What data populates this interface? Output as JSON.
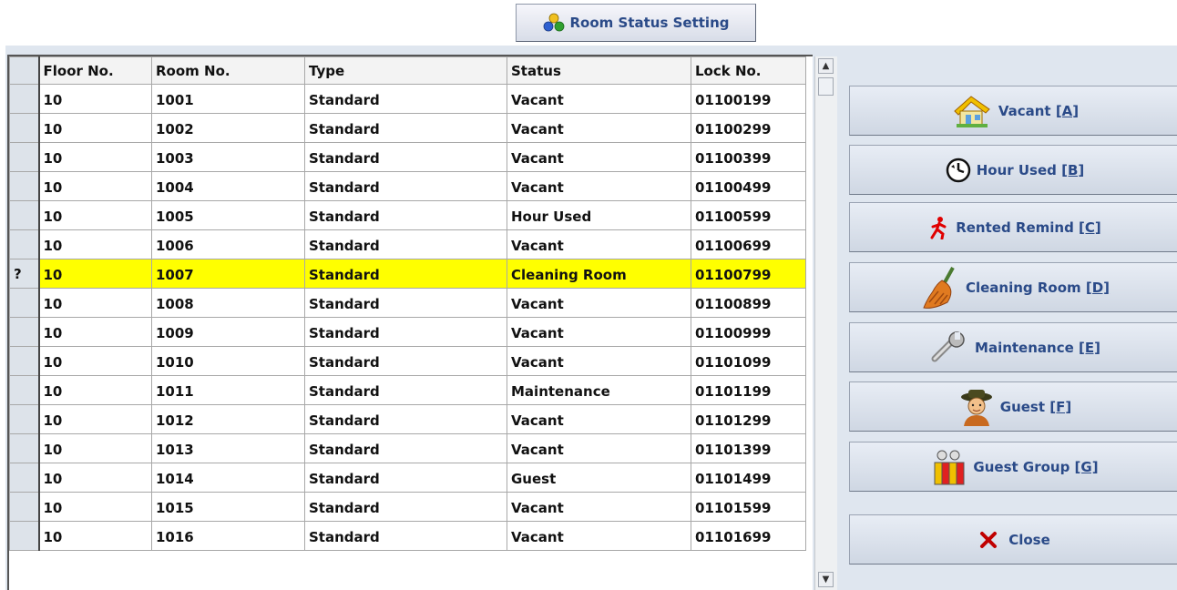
{
  "header": {
    "title": "Room Status Setting"
  },
  "grid": {
    "columns": [
      "Floor No.",
      "Room No.",
      "Type",
      "Status",
      "Lock No."
    ],
    "selected_marker": "?",
    "rows": [
      {
        "floor": "10",
        "room": "1001",
        "type": "Standard",
        "status": "Vacant",
        "lock": "01100199"
      },
      {
        "floor": "10",
        "room": "1002",
        "type": "Standard",
        "status": "Vacant",
        "lock": "01100299"
      },
      {
        "floor": "10",
        "room": "1003",
        "type": "Standard",
        "status": "Vacant",
        "lock": "01100399"
      },
      {
        "floor": "10",
        "room": "1004",
        "type": "Standard",
        "status": "Vacant",
        "lock": "01100499"
      },
      {
        "floor": "10",
        "room": "1005",
        "type": "Standard",
        "status": "Hour Used",
        "lock": "01100599"
      },
      {
        "floor": "10",
        "room": "1006",
        "type": "Standard",
        "status": "Vacant",
        "lock": "01100699"
      },
      {
        "floor": "10",
        "room": "1007",
        "type": "Standard",
        "status": "Cleaning Room",
        "lock": "01100799"
      },
      {
        "floor": "10",
        "room": "1008",
        "type": "Standard",
        "status": "Vacant",
        "lock": "01100899"
      },
      {
        "floor": "10",
        "room": "1009",
        "type": "Standard",
        "status": "Vacant",
        "lock": "01100999"
      },
      {
        "floor": "10",
        "room": "1010",
        "type": "Standard",
        "status": "Vacant",
        "lock": "01101099"
      },
      {
        "floor": "10",
        "room": "1011",
        "type": "Standard",
        "status": "Maintenance",
        "lock": "01101199"
      },
      {
        "floor": "10",
        "room": "1012",
        "type": "Standard",
        "status": "Vacant",
        "lock": "01101299"
      },
      {
        "floor": "10",
        "room": "1013",
        "type": "Standard",
        "status": "Vacant",
        "lock": "01101399"
      },
      {
        "floor": "10",
        "room": "1014",
        "type": "Standard",
        "status": "Guest",
        "lock": "01101499"
      },
      {
        "floor": "10",
        "room": "1015",
        "type": "Standard",
        "status": "Vacant",
        "lock": "01101599"
      },
      {
        "floor": "10",
        "room": "1016",
        "type": "Standard",
        "status": "Vacant",
        "lock": "01101699"
      }
    ]
  },
  "actions": [
    {
      "label": "Vacant ",
      "key": "[A]",
      "icon": "house-icon"
    },
    {
      "label": "Hour Used ",
      "key": "[B]",
      "icon": "clock-icon"
    },
    {
      "label": "Rented Remind ",
      "key": "[C]",
      "icon": "running-man-icon"
    },
    {
      "label": "Cleaning Room ",
      "key": "[D]",
      "icon": "broom-icon"
    },
    {
      "label": "Maintenance ",
      "key": "[E]",
      "icon": "wrench-icon"
    },
    {
      "label": "Guest ",
      "key": "[F]",
      "icon": "guest-icon"
    },
    {
      "label": "Guest Group ",
      "key": "[G]",
      "icon": "guest-group-icon"
    },
    {
      "label": "Close",
      "key": "",
      "icon": "close-x-icon"
    }
  ],
  "colors": {
    "selected_row": "#ffff00",
    "button_text": "#2a4a88",
    "panel_bg": "#dfe6ef"
  }
}
